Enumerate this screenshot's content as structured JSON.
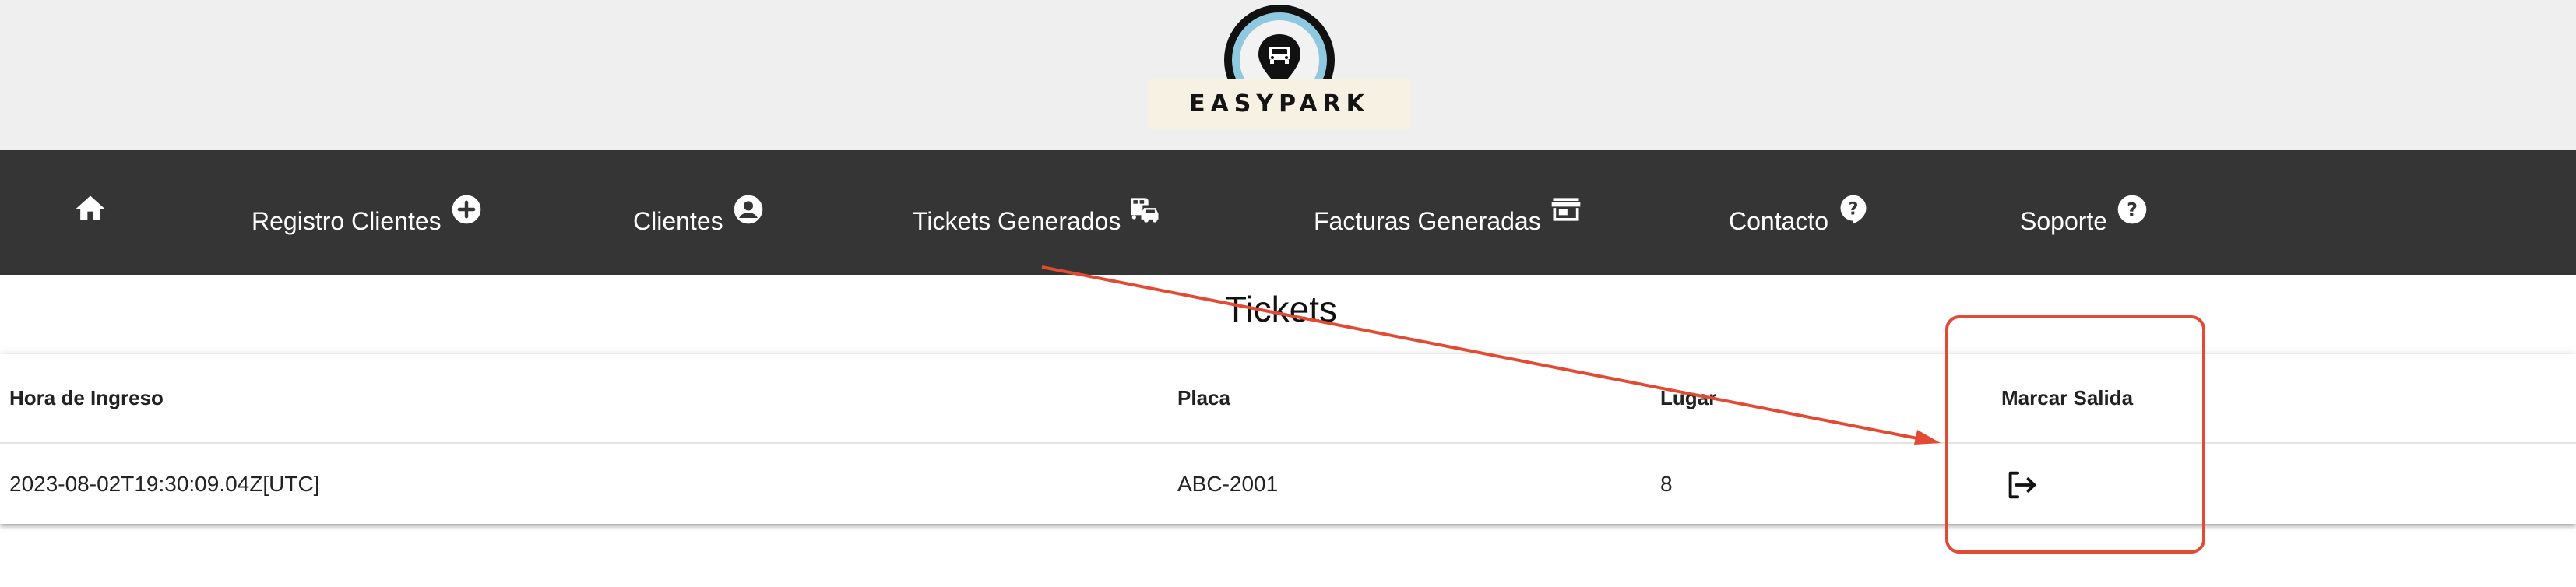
{
  "brand": {
    "name": "EASYPARK",
    "ring_color": "#8fc9df",
    "plate_color": "#f6f1e3"
  },
  "nav": {
    "background": "#353535",
    "items": [
      {
        "label": "",
        "icon": "home-icon"
      },
      {
        "label": "Registro Clientes",
        "icon": "plus-circle-icon"
      },
      {
        "label": "Clientes",
        "icon": "account-circle-icon"
      },
      {
        "label": "Tickets Generados",
        "icon": "car-bus-icon"
      },
      {
        "label": "Facturas Generadas",
        "icon": "store-icon"
      },
      {
        "label": "Contacto",
        "icon": "help-bubble-icon"
      },
      {
        "label": "Soporte",
        "icon": "help-circle-icon"
      }
    ]
  },
  "page": {
    "title": "Tickets"
  },
  "table": {
    "columns": [
      "Hora de Ingreso",
      "Placa",
      "Lugar",
      "Marcar Salida"
    ],
    "rows": [
      {
        "hora_ingreso": "2023-08-02T19:30:09.04Z[UTC]",
        "placa": "ABC-2001",
        "lugar": "8",
        "action_icon": "logout-icon"
      }
    ]
  },
  "annotation": {
    "color": "#e24a34",
    "target": "Marcar Salida"
  }
}
